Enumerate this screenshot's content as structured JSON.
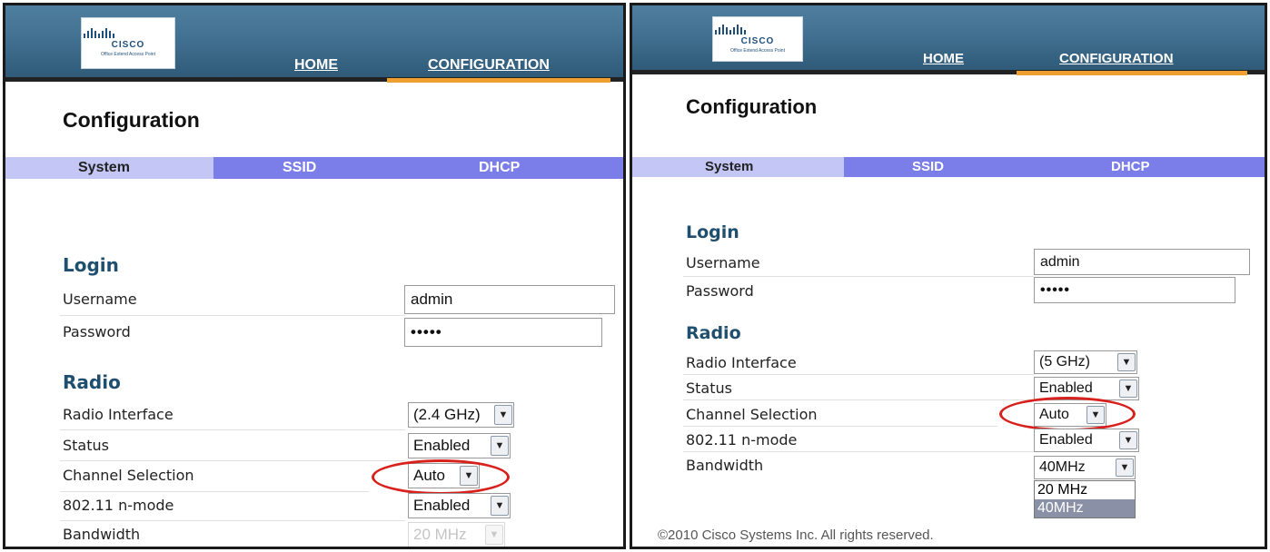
{
  "brand": {
    "logo_word": "CISCO",
    "logo_subtitle": "Office Extend Access Point"
  },
  "nav": {
    "home": "HOME",
    "configuration": "CONFIGURATION"
  },
  "page": {
    "title": "Configuration"
  },
  "tabs": {
    "system": "System",
    "ssid": "SSID",
    "dhcp": "DHCP"
  },
  "login": {
    "section_title": "Login",
    "username_label": "Username",
    "username_value": "admin",
    "password_label": "Password",
    "password_value": "•••••"
  },
  "radio": {
    "section_title": "Radio",
    "interface_label": "Radio Interface",
    "status_label": "Status",
    "channel_label": "Channel Selection",
    "nmode_label": "802.11 n-mode",
    "bandwidth_label": "Bandwidth"
  },
  "left_panel": {
    "interface_value": "(2.4 GHz)",
    "status_value": "Enabled",
    "channel_value": "Auto",
    "nmode_value": "Enabled",
    "bandwidth_value": "20 MHz"
  },
  "right_panel": {
    "interface_value": "(5 GHz)",
    "status_value": "Enabled",
    "channel_value": "Auto",
    "nmode_value": "Enabled",
    "bandwidth_value": "40MHz",
    "bandwidth_options": [
      "20 MHz",
      "40MHz"
    ]
  },
  "footer": {
    "copyright": "©2010 Cisco Systems Inc. All rights reserved."
  },
  "colors": {
    "header": "#3f6d8d",
    "tab_bar": "#7b7de8",
    "tab_active": "#c4c6f6",
    "nav_active": "#f0a030",
    "section_title": "#1f4f6e",
    "highlight": "#d8201c"
  }
}
